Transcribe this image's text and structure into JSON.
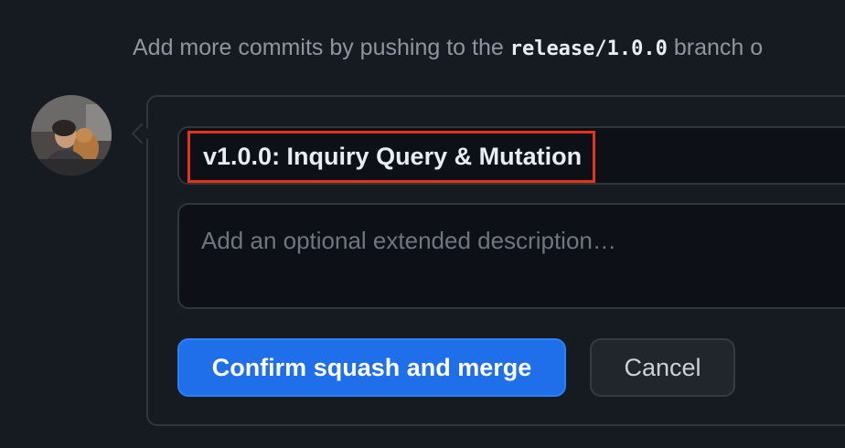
{
  "hint": {
    "prefix": "Add more commits by pushing to the ",
    "branch": "release/1.0.0",
    "suffix": " branch o"
  },
  "avatar": {
    "icon": "user-avatar-photo"
  },
  "merge_form": {
    "commit_title": "v1.0.0: Inquiry Query & Mutation",
    "description_placeholder": "Add an optional extended description…",
    "confirm_label": "Confirm squash and merge",
    "cancel_label": "Cancel"
  },
  "colors": {
    "background": "#161b22",
    "input_background": "#0d1117",
    "border": "#30363d",
    "primary": "#1f6feb",
    "highlight": "#e5321c"
  }
}
